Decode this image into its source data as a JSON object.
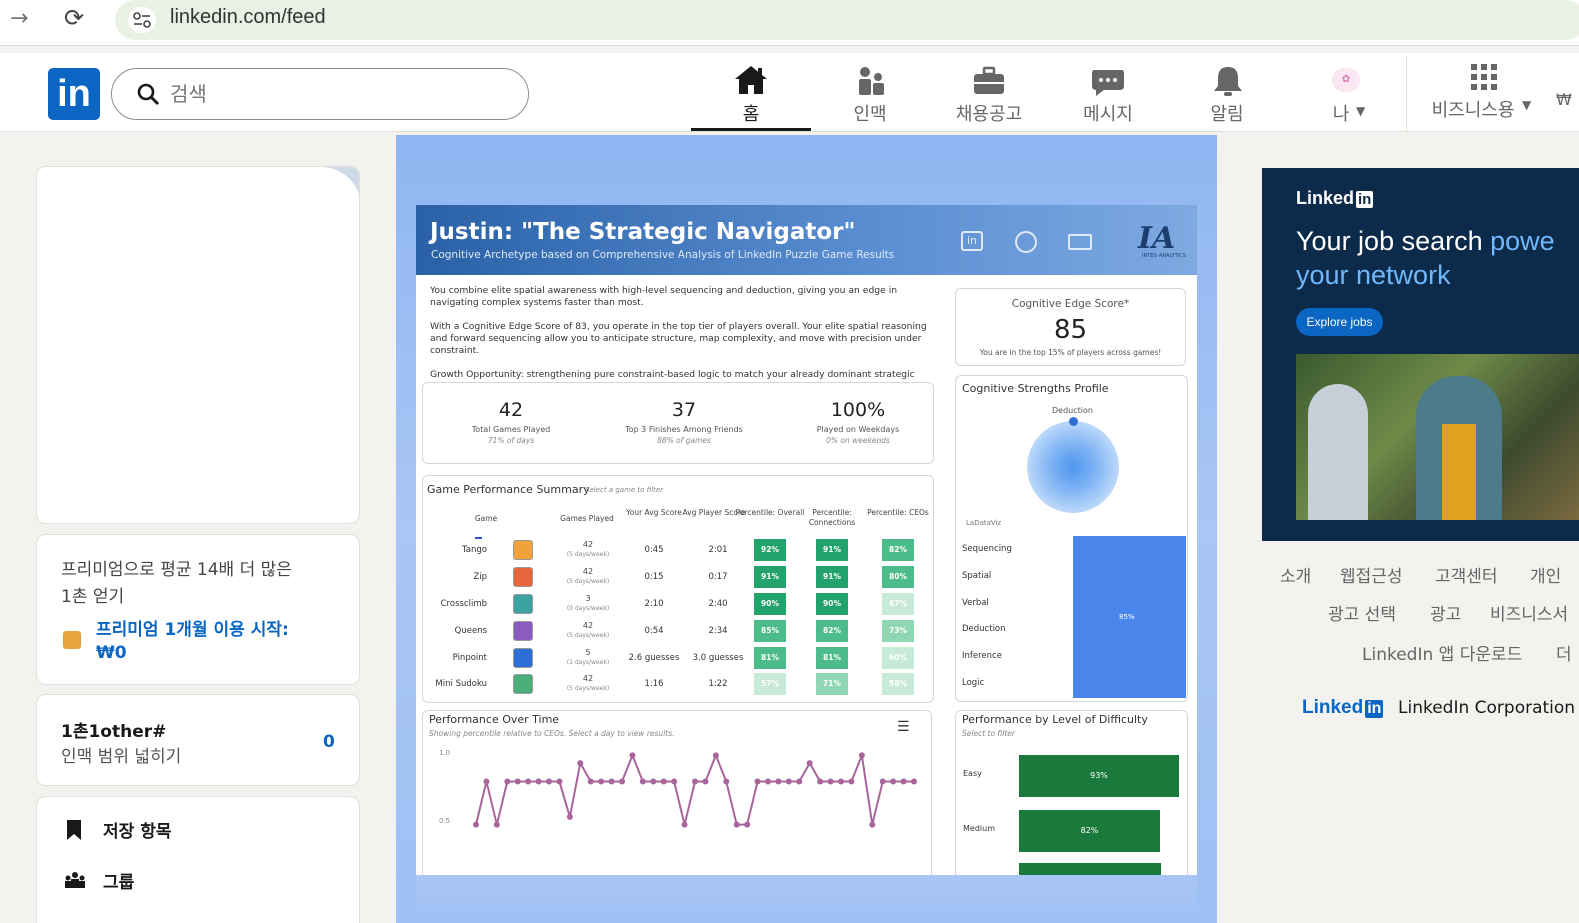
{
  "browser": {
    "url": "linkedin.com/feed"
  },
  "nav": {
    "logo": "in",
    "search_placeholder": "검색",
    "items": [
      {
        "label": "홈",
        "icon": "home-icon",
        "active": true
      },
      {
        "label": "인맥",
        "icon": "people-icon"
      },
      {
        "label": "채용공고",
        "icon": "briefcase-icon"
      },
      {
        "label": "메시지",
        "icon": "message-icon"
      },
      {
        "label": "알림",
        "icon": "bell-icon"
      },
      {
        "label": "나",
        "icon": "avatar"
      },
      {
        "label": "비즈니스용",
        "icon": "grid-icon"
      }
    ],
    "trailing": "₩"
  },
  "left": {
    "premium": {
      "line1": "프리미엄으로 평균 14배 더 많은",
      "line2": "1촌 얻기",
      "cta1": "프리미엄 1개월 이용 시작:",
      "cta2": "₩0"
    },
    "network": {
      "title": "1촌1other#",
      "subtitle": "인맥 범위 넓히기",
      "count": "0"
    },
    "links": [
      {
        "label": "저장 항목",
        "icon": "bookmark-icon"
      },
      {
        "label": "그룹",
        "icon": "groups-icon"
      }
    ]
  },
  "post": {
    "title": "Justin: \"The Strategic Navigator\"",
    "subtitle": "Cognitive Archetype based on Comprehensive Analysis of LinkedIn Puzzle Game Results",
    "brand": "INTEG ANALYTICS",
    "para1": "You combine elite spatial awareness with high-level sequencing and deduction, giving you an edge in navigating complex systems faster than most.",
    "para2": "With a Cognitive Edge Score of 83, you operate in the top tier of players overall. Your elite spatial reasoning and forward sequencing allow you to anticipate structure, map complexity, and move with precision under constraint.",
    "para3": "Growth Opportunity: strengthening pure constraint-based logic to match your already dominant strategic instincts.",
    "score_title": "Cognitive Edge Score*",
    "score": "85",
    "score_note": "You are in the top 15% of players across games!",
    "stats": [
      {
        "value": "42",
        "label": "Total Games Played",
        "sub": "71% of days"
      },
      {
        "value": "37",
        "label": "Top 3 Finishes Among Friends",
        "sub": "88% of games"
      },
      {
        "value": "100%",
        "label": "Played on Weekdays",
        "sub": "0% on weekends"
      }
    ],
    "summary_title": "Game Performance Summary",
    "summary_hint": "Select a game to filter",
    "columns": [
      "Game",
      "Games Played",
      "Your Avg Score",
      "Avg Player Score",
      "Percentile: Overall",
      "Percentile: Connections",
      "Percentile: CEOs"
    ],
    "rows": [
      {
        "game": "Tango",
        "played": "42",
        "freq": "(5 days/week)",
        "you": "0:45",
        "avg": "2:01",
        "p1": "92%",
        "p2": "91%",
        "p3": "82%",
        "color": "#f2a23a"
      },
      {
        "game": "Zip",
        "played": "42",
        "freq": "(5 days/week)",
        "you": "0:15",
        "avg": "0:17",
        "p1": "91%",
        "p2": "91%",
        "p3": "80%",
        "color": "#e8643a"
      },
      {
        "game": "Crossclimb",
        "played": "3",
        "freq": "(0 days/week)",
        "you": "2:10",
        "avg": "2:40",
        "p1": "90%",
        "p2": "90%",
        "p3": "67%",
        "color": "#3aa3a0"
      },
      {
        "game": "Queens",
        "played": "42",
        "freq": "(5 days/week)",
        "you": "0:54",
        "avg": "2:34",
        "p1": "85%",
        "p2": "82%",
        "p3": "73%",
        "color": "#8a5cc2"
      },
      {
        "game": "Pinpoint",
        "played": "5",
        "freq": "(1 days/week)",
        "you": "2.6 guesses",
        "avg": "3.0 guesses",
        "p1": "81%",
        "p2": "81%",
        "p3": "60%",
        "color": "#2d6fd6"
      },
      {
        "game": "Mini Sudoku",
        "played": "42",
        "freq": "(5 days/week)",
        "you": "1:16",
        "avg": "1:22",
        "p1": "57%",
        "p2": "71%",
        "p3": "58%",
        "color": "#49b07a"
      }
    ],
    "strengths_title": "Cognitive Strengths Profile",
    "strengths_top": "Deduction",
    "strengths_brand": "LaDataViz",
    "strengths": [
      {
        "label": "Sequencing"
      },
      {
        "label": "Spatial"
      },
      {
        "label": "Verbal"
      },
      {
        "label": "Deduction"
      },
      {
        "label": "Inference"
      },
      {
        "label": "Logic"
      }
    ],
    "strengths_bar": "85%",
    "time_title": "Performance Over Time",
    "time_hint": "Showing percentile relative to CEOs. Select a day to view results.",
    "time_ticks": [
      "1.0",
      "0.5"
    ],
    "difficulty_title": "Performance by Level of Difficulty",
    "difficulty_hint": "Select to filter",
    "difficulty": [
      {
        "label": "Easy",
        "value": 0.93,
        "text": "93%"
      },
      {
        "label": "Medium",
        "value": 0.82,
        "text": "82%"
      }
    ]
  },
  "chart_data": {
    "type": "line",
    "title": "Performance Over Time",
    "ylim": [
      0.4,
      1.05
    ],
    "y_ticks": [
      1.0,
      0.5
    ],
    "values": [
      0.5,
      0.78,
      0.5,
      0.78,
      0.78,
      0.78,
      0.78,
      0.78,
      0.78,
      0.55,
      0.9,
      0.78,
      0.78,
      0.78,
      0.78,
      0.95,
      0.78,
      0.78,
      0.78,
      0.78,
      0.5,
      0.78,
      0.78,
      0.95,
      0.78,
      0.5,
      0.5,
      0.78,
      0.78,
      0.78,
      0.78,
      0.78,
      0.9,
      0.78,
      0.78,
      0.78,
      0.78,
      0.95,
      0.5,
      0.78,
      0.78,
      0.78,
      0.78
    ],
    "color": "#a8659c"
  },
  "ad": {
    "brand": "Linked",
    "line1": "Your job search ",
    "line1b": "powe",
    "line2": "your network",
    "cta": "Explore jobs"
  },
  "footer": {
    "row1": [
      "소개",
      "웹접근성",
      "고객센터",
      "개인"
    ],
    "row2": [
      "광고 선택",
      "광고",
      "비즈니스서"
    ],
    "row3": [
      "LinkedIn 앱 다운로드",
      "더"
    ],
    "brand": "Linked",
    "corp": "LinkedIn Corporation"
  }
}
